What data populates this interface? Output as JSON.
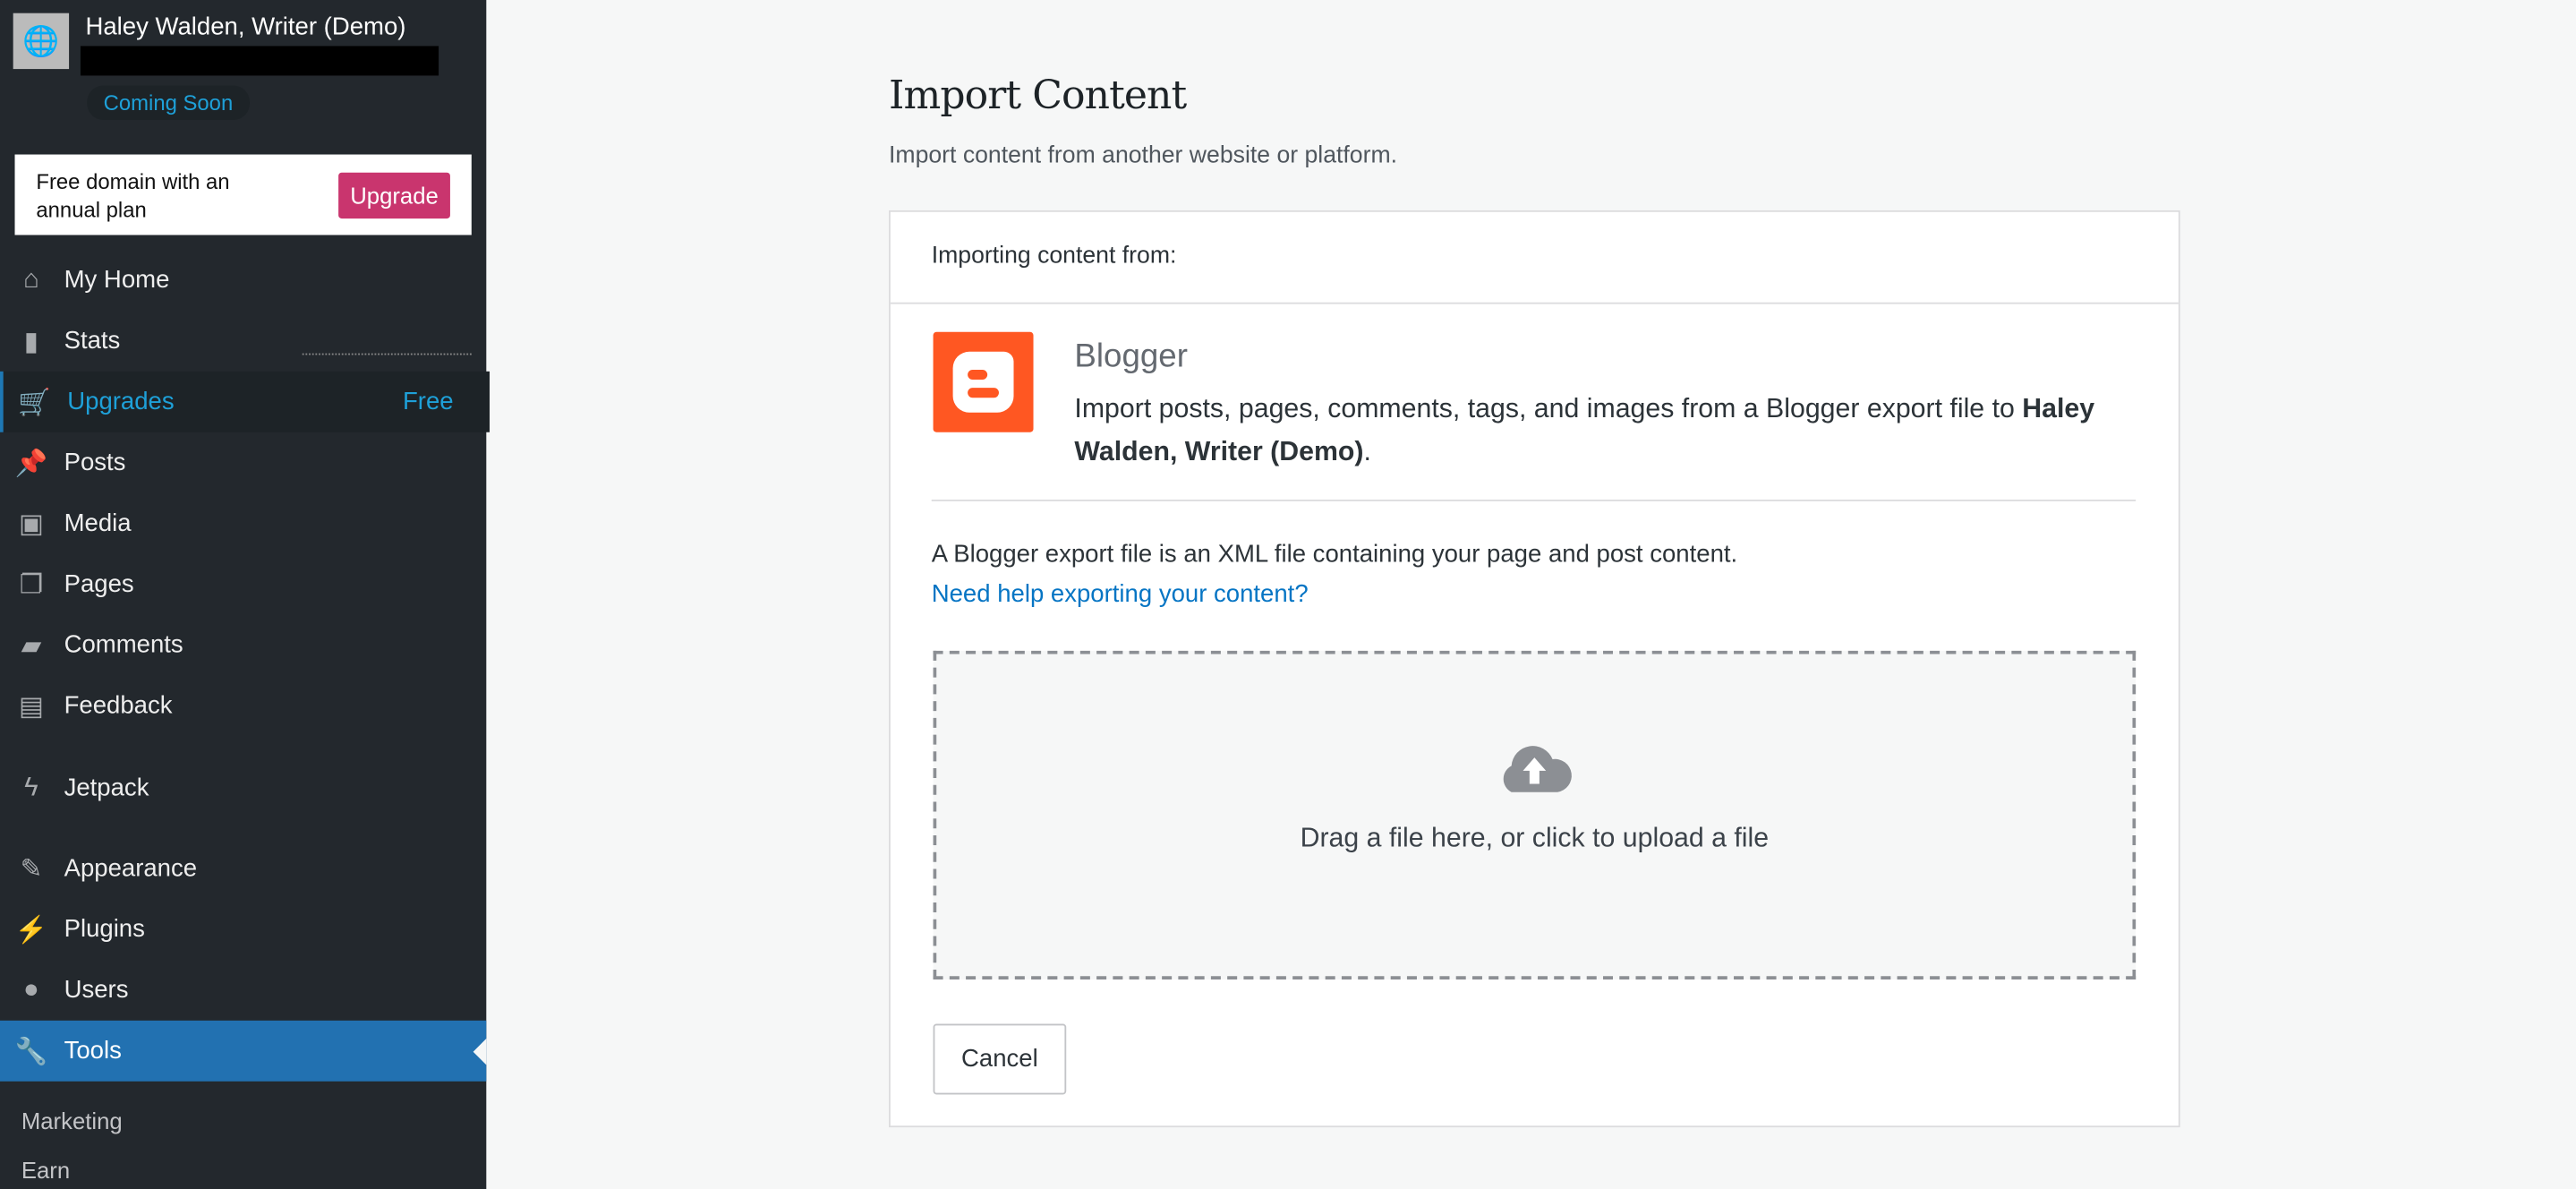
{
  "site": {
    "name": "Haley Walden, Writer (Demo)",
    "status_badge": "Coming Soon"
  },
  "promo": {
    "text": "Free domain with an annual plan",
    "button": "Upgrade"
  },
  "nav": [
    {
      "label": "My Home",
      "icon": "home-icon"
    },
    {
      "label": "Stats",
      "icon": "stats-icon"
    },
    {
      "label": "Upgrades",
      "icon": "cart-icon",
      "extra": "Free"
    },
    {
      "label": "Posts",
      "icon": "pin-icon"
    },
    {
      "label": "Media",
      "icon": "media-icon"
    },
    {
      "label": "Pages",
      "icon": "pages-icon"
    },
    {
      "label": "Comments",
      "icon": "comment-icon"
    },
    {
      "label": "Feedback",
      "icon": "feedback-icon"
    },
    {
      "label": "Jetpack",
      "icon": "jetpack-icon"
    },
    {
      "label": "Appearance",
      "icon": "brush-icon"
    },
    {
      "label": "Plugins",
      "icon": "plug-icon"
    },
    {
      "label": "Users",
      "icon": "user-icon"
    },
    {
      "label": "Tools",
      "icon": "wrench-icon"
    }
  ],
  "subnav": [
    "Marketing",
    "Earn"
  ],
  "main": {
    "title": "Import Content",
    "subtitle": "Import content from another website or platform.",
    "card_header": "Importing content from:",
    "importer": {
      "name": "Blogger",
      "desc_prefix": "Import posts, pages, comments, tags, and images from a Blogger export file to ",
      "desc_site": "Haley Walden, Writer (Demo)",
      "desc_suffix": "."
    },
    "info": "A Blogger export file is an XML file containing your page and post content.",
    "help_link": "Need help exporting your content?",
    "dropzone": "Drag a file here, or click to upload a file",
    "cancel": "Cancel"
  },
  "colors": {
    "sidebar": "#23282d",
    "accent": "#2271b1",
    "upgrade": "#c9356e",
    "blogger": "#ff5722",
    "link": "#0675c4"
  }
}
